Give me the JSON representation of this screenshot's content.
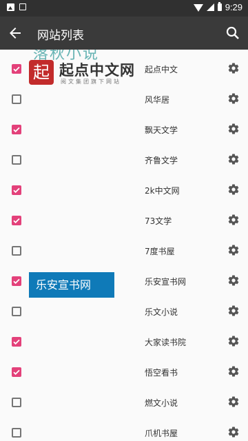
{
  "status_bar": {
    "time": "9:29"
  },
  "toolbar": {
    "title": "网站列表",
    "back_icon": "arrow-back-icon",
    "search_icon": "search-icon"
  },
  "logos": {
    "qidian_seal": "起",
    "qidian_name": "起点中文网",
    "qidian_sub": "阅文集团旗下网站",
    "leanxuan": "乐安宣书网",
    "top_partial": "落秋小说"
  },
  "sites": [
    {
      "name": "落秋小说",
      "checked": true
    },
    {
      "name": "起点中文",
      "checked": true
    },
    {
      "name": "风华居",
      "checked": false
    },
    {
      "name": "飘天文学",
      "checked": true
    },
    {
      "name": "齐鲁文学",
      "checked": false
    },
    {
      "name": "2k中文网",
      "checked": true
    },
    {
      "name": "73文学",
      "checked": true
    },
    {
      "name": "7度书屋",
      "checked": false
    },
    {
      "name": "乐安宣书网",
      "checked": true
    },
    {
      "name": "乐文小说",
      "checked": false
    },
    {
      "name": "大家读书院",
      "checked": true
    },
    {
      "name": "悟空看书",
      "checked": true
    },
    {
      "name": "燃文小说",
      "checked": false
    },
    {
      "name": "爪机书屋",
      "checked": false
    }
  ],
  "colors": {
    "accent": "#e3417a",
    "toolbar": "#3a3a3a",
    "status_bar": "#303030"
  }
}
